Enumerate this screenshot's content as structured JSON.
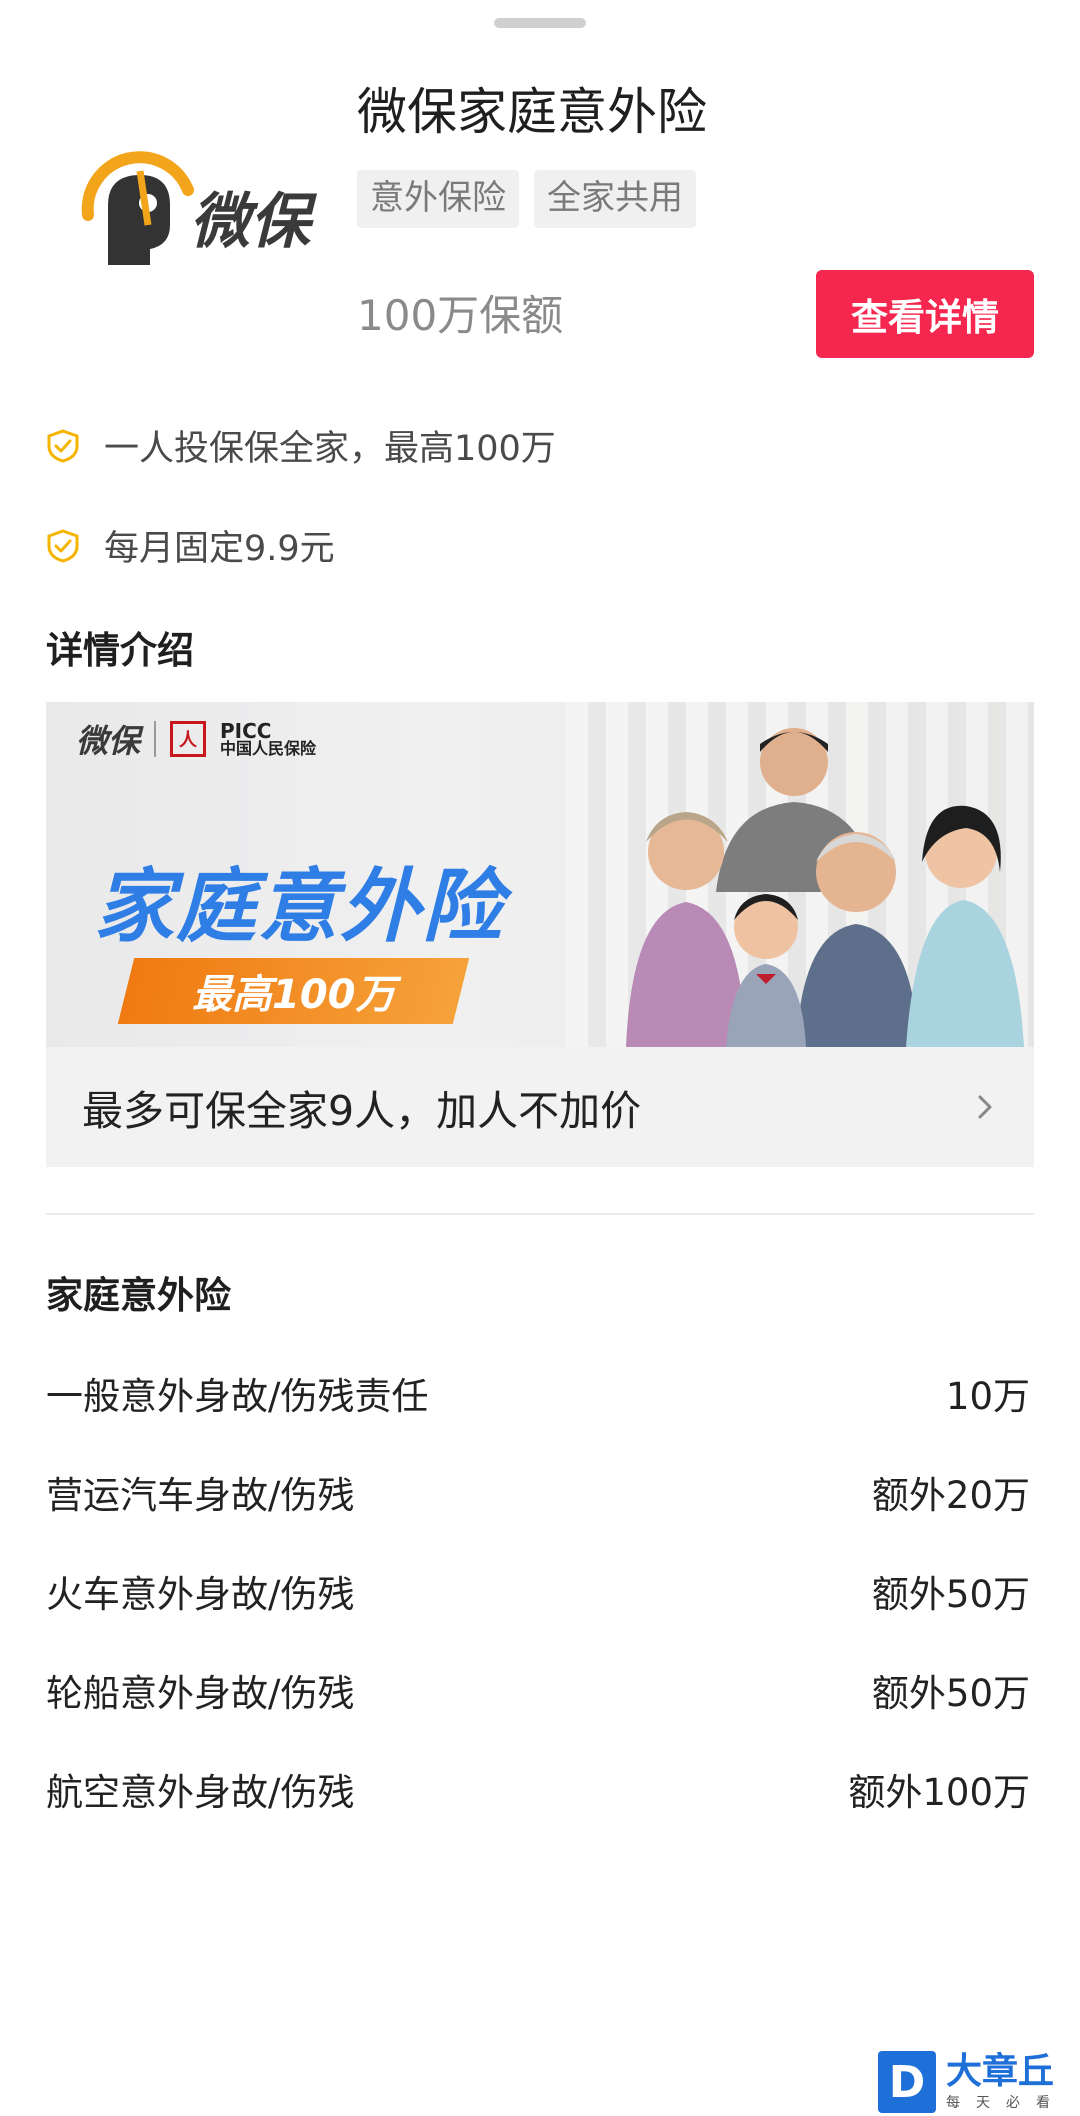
{
  "product": {
    "title": "微保家庭意外险",
    "tags": [
      "意外保险",
      "全家共用"
    ],
    "coverage": "100万保额",
    "detail_button": "查看详情",
    "logo_text": "微保"
  },
  "features": [
    {
      "text": "一人投保保全家，最高100万"
    },
    {
      "text": "每月固定9.9元"
    }
  ],
  "details": {
    "title": "详情介绍",
    "banner": {
      "brand1": "微保",
      "brand2_en": "PICC",
      "brand2_cn": "中国人民保险",
      "headline": "家庭意外险",
      "badge": "最高100万"
    },
    "caption": "最多可保全家9人，加人不加价"
  },
  "plan": {
    "title": "家庭意外险",
    "rows": [
      {
        "label": "一般意外身故/伤残责任",
        "amount": "10万"
      },
      {
        "label": "营运汽车身故/伤残",
        "amount": "额外20万"
      },
      {
        "label": "火车意外身故/伤残",
        "amount": "额外50万"
      },
      {
        "label": "轮船意外身故/伤残",
        "amount": "额外50万"
      },
      {
        "label": "航空意外身故/伤残",
        "amount": "额外100万"
      }
    ]
  },
  "watermark": {
    "letter": "D",
    "name": "大章丘",
    "slogan": "每天必看"
  },
  "colors": {
    "accent": "#f5274e",
    "check": "#f5b400",
    "banner_blue": "#2f7ee6",
    "badge_orange": "#f07a12"
  }
}
